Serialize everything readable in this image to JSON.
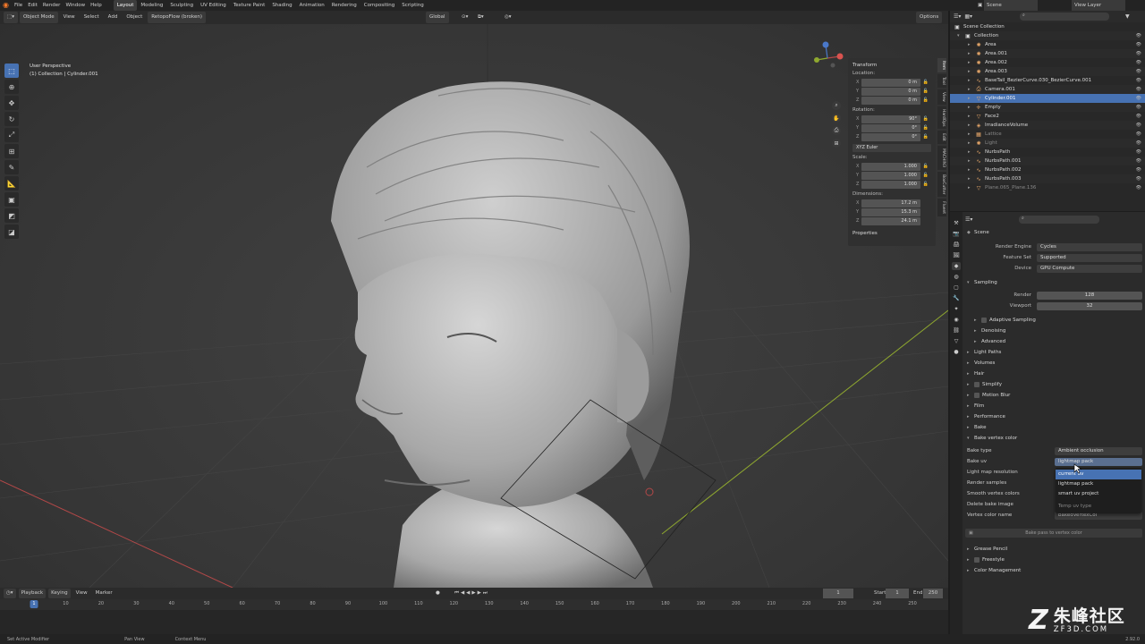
{
  "menubar": {
    "menus": [
      "File",
      "Edit",
      "Render",
      "Window",
      "Help"
    ],
    "workspaces": [
      "Layout",
      "Modeling",
      "Sculpting",
      "UV Editing",
      "Texture Paint",
      "Shading",
      "Animation",
      "Rendering",
      "Compositing",
      "Scripting"
    ],
    "active_workspace": "Layout",
    "scene": "Scene",
    "view_layer": "View Layer"
  },
  "viewport_header": {
    "mode": "Object Mode",
    "menus": [
      "View",
      "Select",
      "Add",
      "Object"
    ],
    "addon_dropdown": "RetopoFlow (broken)",
    "transform_orientation": "Global",
    "options_label": "Options"
  },
  "viewport": {
    "view_name": "User Perspective",
    "collection_line": "(1) Collection | Cylinder.001"
  },
  "npanel": {
    "transform_title": "Transform",
    "location_label": "Location:",
    "location": {
      "x": "0 m",
      "y": "0 m",
      "z": "0 m"
    },
    "rotation_label": "Rotation:",
    "rotation": {
      "x": "90°",
      "y": "0°",
      "z": "0°"
    },
    "rotation_mode": "XYZ Euler",
    "scale_label": "Scale:",
    "scale": {
      "x": "1.000",
      "y": "1.000",
      "z": "1.000"
    },
    "dimensions_label": "Dimensions:",
    "dimensions": {
      "x": "17.2 m",
      "y": "15.3 m",
      "z": "24.1 m"
    },
    "properties_title": "Properties",
    "tabs": [
      "Item",
      "Tool",
      "View",
      "HardOps",
      "Edit",
      "MACHIN3",
      "BoxCutter",
      "Fluent",
      "Retopo",
      "Sculpt"
    ]
  },
  "outliner": {
    "title": "Scene Collection",
    "items": [
      {
        "name": "Collection",
        "icon": "collection-icon",
        "depth": 0
      },
      {
        "name": "Area",
        "icon": "light-icon"
      },
      {
        "name": "Area.001",
        "icon": "light-icon"
      },
      {
        "name": "Area.002",
        "icon": "light-icon"
      },
      {
        "name": "Area.003",
        "icon": "light-icon"
      },
      {
        "name": "BaseTail_BezierCurve.030_BezierCurve.001",
        "icon": "curve-icon"
      },
      {
        "name": "Camera.001",
        "icon": "camera-icon"
      },
      {
        "name": "Cylinder.001",
        "icon": "mesh-icon",
        "selected": true
      },
      {
        "name": "Empty",
        "icon": "empty-icon"
      },
      {
        "name": "Face2",
        "icon": "mesh-icon"
      },
      {
        "name": "IrradianceVolume",
        "icon": "probe-icon"
      },
      {
        "name": "Lattice",
        "icon": "lattice-icon",
        "dim": true
      },
      {
        "name": "Light",
        "icon": "light-icon",
        "dim": true
      },
      {
        "name": "NurbsPath",
        "icon": "curve-icon"
      },
      {
        "name": "NurbsPath.001",
        "icon": "curve-icon"
      },
      {
        "name": "NurbsPath.002",
        "icon": "curve-icon"
      },
      {
        "name": "NurbsPath.003",
        "icon": "curve-icon"
      },
      {
        "name": "Plane.065_Plane.136",
        "icon": "mesh-icon",
        "dim": true
      }
    ]
  },
  "properties": {
    "context": "Scene",
    "render_engine_label": "Render Engine",
    "render_engine": "Cycles",
    "feature_set_label": "Feature Set",
    "feature_set": "Supported",
    "device_label": "Device",
    "device": "GPU Compute",
    "sampling": "Sampling",
    "render_label": "Render",
    "render_samples": "128",
    "viewport_label": "Viewport",
    "viewport_samples": "32",
    "adaptive_sampling": "Adaptive Sampling",
    "denoising": "Denoising",
    "advanced": "Advanced",
    "panels": [
      "Light Paths",
      "Volumes",
      "Hair",
      "Simplify",
      "Motion Blur",
      "Film",
      "Performance",
      "Bake"
    ],
    "bake_vertex_color": "Bake vertex color",
    "bake_type_label": "Bake type",
    "bake_type": "Ambient occlusion",
    "bake_uv_label": "Bake uv",
    "bake_uv": "lightmap pack",
    "lightmap_resolution_label": "Light map resolution",
    "render_samples_label": "Render samples",
    "smooth_vertex_colors_label": "Smooth vertex colors",
    "delete_bake_image_label": "Delete bake image",
    "vertex_color_name_label": "Vertex color name",
    "vertex_color_name": "bakedVertexCol",
    "bake_button": "Bake pass to vertex color",
    "bottom_panels": [
      "Grease Pencil",
      "Freestyle",
      "Color Management"
    ],
    "dropdown_options": [
      "current uv",
      "lightmap pack",
      "smart uv project"
    ],
    "dropdown_hint": "Temp uv type"
  },
  "timeline": {
    "menus": [
      "Playback",
      "Keying",
      "View",
      "Marker"
    ],
    "current_frame": "1",
    "start_label": "Start",
    "start": "1",
    "end_label": "End",
    "end": "250",
    "ticks": [
      "10",
      "20",
      "30",
      "40",
      "50",
      "60",
      "70",
      "80",
      "90",
      "100",
      "110",
      "120",
      "130",
      "140",
      "150",
      "160",
      "170",
      "180",
      "190",
      "200",
      "210",
      "220",
      "230",
      "240",
      "250"
    ],
    "playhead": "1"
  },
  "statusbar": {
    "left": "Set Active Modifier",
    "mid": "Pan View",
    "right": "Context Menu",
    "version": "2.92.0"
  },
  "watermark": {
    "cn": "朱峰社区",
    "site": "ZF3D.COM"
  },
  "colors": {
    "accent": "#4772b3",
    "axis_x": "#b34848",
    "axis_y": "#8fa82f",
    "axis_z": "#4a78c9"
  }
}
